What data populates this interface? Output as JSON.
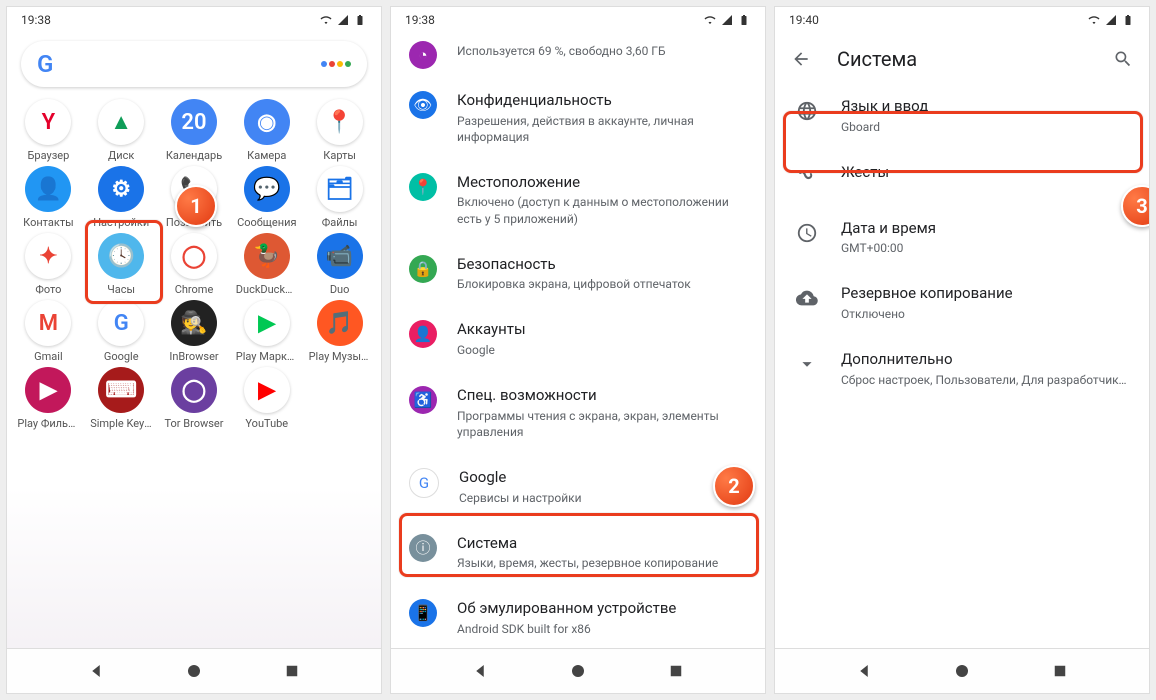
{
  "status": {
    "s1_time": "19:38",
    "s2_time": "19:38",
    "s3_time": "19:40"
  },
  "screen1": {
    "apps": [
      {
        "label": "Браузер",
        "bg": "#fff",
        "glyph": "Y",
        "fg": "#e4002b"
      },
      {
        "label": "Диск",
        "bg": "#fff",
        "glyph": "▲",
        "fg": "#0f9d58"
      },
      {
        "label": "Календарь",
        "bg": "#4285f4",
        "glyph": "20",
        "fg": "#fff"
      },
      {
        "label": "Камера",
        "bg": "#4285f4",
        "glyph": "◉",
        "fg": "#fff"
      },
      {
        "label": "Карты",
        "bg": "#fff",
        "glyph": "📍",
        "fg": "#34a853"
      },
      {
        "label": "Контакты",
        "bg": "#2196f3",
        "glyph": "👤",
        "fg": "#fff"
      },
      {
        "label": "Настройки",
        "bg": "#1a73e8",
        "glyph": "⚙",
        "fg": "#fff"
      },
      {
        "label": "Позвонить",
        "bg": "#fff",
        "glyph": "📞",
        "fg": "#1a73e8"
      },
      {
        "label": "Сообщения",
        "bg": "#1a73e8",
        "glyph": "💬",
        "fg": "#fff"
      },
      {
        "label": "Файлы",
        "bg": "#fff",
        "glyph": "🗂",
        "fg": "#1a73e8"
      },
      {
        "label": "Фото",
        "bg": "#fff",
        "glyph": "✦",
        "fg": "#ea4335"
      },
      {
        "label": "Часы",
        "bg": "#4fb7ec",
        "glyph": "🕓",
        "fg": "#fff"
      },
      {
        "label": "Chrome",
        "bg": "#fff",
        "glyph": "◯",
        "fg": "#ea4335"
      },
      {
        "label": "DuckDuckGo",
        "bg": "#de5833",
        "glyph": "🦆",
        "fg": "#fff"
      },
      {
        "label": "Duo",
        "bg": "#1a73e8",
        "glyph": "📹",
        "fg": "#fff"
      },
      {
        "label": "Gmail",
        "bg": "#fff",
        "glyph": "M",
        "fg": "#ea4335"
      },
      {
        "label": "Google",
        "bg": "#fff",
        "glyph": "G",
        "fg": "#4285f4"
      },
      {
        "label": "InBrowser",
        "bg": "#222",
        "glyph": "🕵",
        "fg": "#fff"
      },
      {
        "label": "Play Маркет",
        "bg": "#fff",
        "glyph": "▶",
        "fg": "#00c853"
      },
      {
        "label": "Play Музыка",
        "bg": "#ff5722",
        "glyph": "🎵",
        "fg": "#fff"
      },
      {
        "label": "Play Фильмы",
        "bg": "#c2185b",
        "glyph": "▶",
        "fg": "#fff"
      },
      {
        "label": "Simple Keyboard",
        "bg": "#a61b1b",
        "glyph": "⌨",
        "fg": "#fff"
      },
      {
        "label": "Tor Browser",
        "bg": "#6b3fa0",
        "glyph": "◯",
        "fg": "#fff"
      },
      {
        "label": "YouTube",
        "bg": "#fff",
        "glyph": "▶",
        "fg": "#ff0000"
      }
    ]
  },
  "screen2": {
    "header_sub": "Используется 69 %, свободно 3,60 ГБ",
    "rows": [
      {
        "icon": "👁",
        "bg": "#1a73e8",
        "title": "Конфиденциальность",
        "sub": "Разрешения, действия в аккаунте, личная информация"
      },
      {
        "icon": "📍",
        "bg": "#00bfa5",
        "title": "Местоположение",
        "sub": "Включено (доступ к данным о местоположении есть у 5 приложений)"
      },
      {
        "icon": "🔒",
        "bg": "#34a853",
        "title": "Безопасность",
        "sub": "Блокировка экрана, цифровой отпечаток"
      },
      {
        "icon": "👤",
        "bg": "#e91e63",
        "title": "Аккаунты",
        "sub": "Google"
      },
      {
        "icon": "♿",
        "bg": "#9c27b0",
        "title": "Спец. возможности",
        "sub": "Программы чтения с экрана, экран, элементы управления"
      },
      {
        "icon": "G",
        "bg": "#fff",
        "fg": "#4285f4",
        "title": "Google",
        "sub": "Сервисы и настройки"
      },
      {
        "icon": "ⓘ",
        "bg": "#78909c",
        "title": "Система",
        "sub": "Языки, время, жесты, резервное копирование"
      },
      {
        "icon": "📱",
        "bg": "#1a73e8",
        "title": "Об эмулированном устройстве",
        "sub": "Android SDK built for x86"
      }
    ]
  },
  "screen3": {
    "title": "Система",
    "rows": [
      {
        "icon": "globe",
        "title": "Язык и ввод",
        "sub": "Gboard"
      },
      {
        "icon": "gesture",
        "title": "Жесты",
        "sub": ""
      },
      {
        "icon": "clock",
        "title": "Дата и время",
        "sub": "GMT+00:00"
      },
      {
        "icon": "backup",
        "title": "Резервное копирование",
        "sub": "Отключено"
      },
      {
        "icon": "expand",
        "title": "Дополнительно",
        "sub": "Сброс настроек, Пользователи, Для разработчиков"
      }
    ]
  },
  "badges": {
    "s1": "1",
    "s2": "2",
    "s3": "3"
  }
}
